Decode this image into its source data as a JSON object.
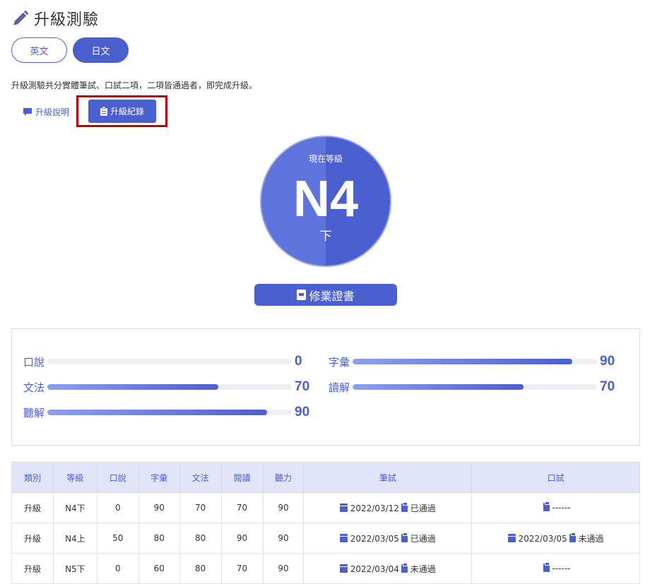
{
  "header": {
    "title": "升級測驗"
  },
  "lang_tabs": [
    {
      "label": "英文",
      "active": false
    },
    {
      "label": "日文",
      "active": true
    }
  ],
  "description": "升級測驗共分實體筆試、口試二項，二項皆通過者，即完成升級。",
  "subtabs": {
    "info_label": "升級說明",
    "record_label": "升級紀錄"
  },
  "level": {
    "label": "現在等級",
    "value": "N4",
    "sub": "下"
  },
  "certificate_label": "修業證書",
  "scores": [
    {
      "name": "口說",
      "value": "0",
      "fraction": 0.0
    },
    {
      "name": "字彙",
      "value": "90",
      "fraction": 0.9
    },
    {
      "name": "文法",
      "value": "70",
      "fraction": 0.7
    },
    {
      "name": "讀解",
      "value": "70",
      "fraction": 0.7
    },
    {
      "name": "聽解",
      "value": "90",
      "fraction": 0.9
    }
  ],
  "table": {
    "headers": [
      "類別",
      "等級",
      "口說",
      "字彙",
      "文法",
      "閱讀",
      "聽力",
      "筆試",
      "口試"
    ],
    "rows": [
      {
        "type": "升級",
        "level": "N4下",
        "speak": "0",
        "vocab": "90",
        "grammar": "70",
        "read": "70",
        "listen": "90",
        "written_date": "2022/03/12",
        "written_status": "已通過",
        "oral_date": "",
        "oral_status": "------"
      },
      {
        "type": "升級",
        "level": "N4上",
        "speak": "50",
        "vocab": "80",
        "grammar": "80",
        "read": "90",
        "listen": "90",
        "written_date": "2022/03/05",
        "written_status": "已通過",
        "oral_date": "2022/03/05",
        "oral_status": "未通過"
      },
      {
        "type": "升級",
        "level": "N5下",
        "speak": "0",
        "vocab": "60",
        "grammar": "80",
        "read": "70",
        "listen": "90",
        "written_date": "2022/03/04",
        "written_status": "未通過",
        "oral_date": "",
        "oral_status": "------"
      }
    ]
  },
  "colors": {
    "accent": "#4a5fd0",
    "highlight_border": "#c00000"
  }
}
